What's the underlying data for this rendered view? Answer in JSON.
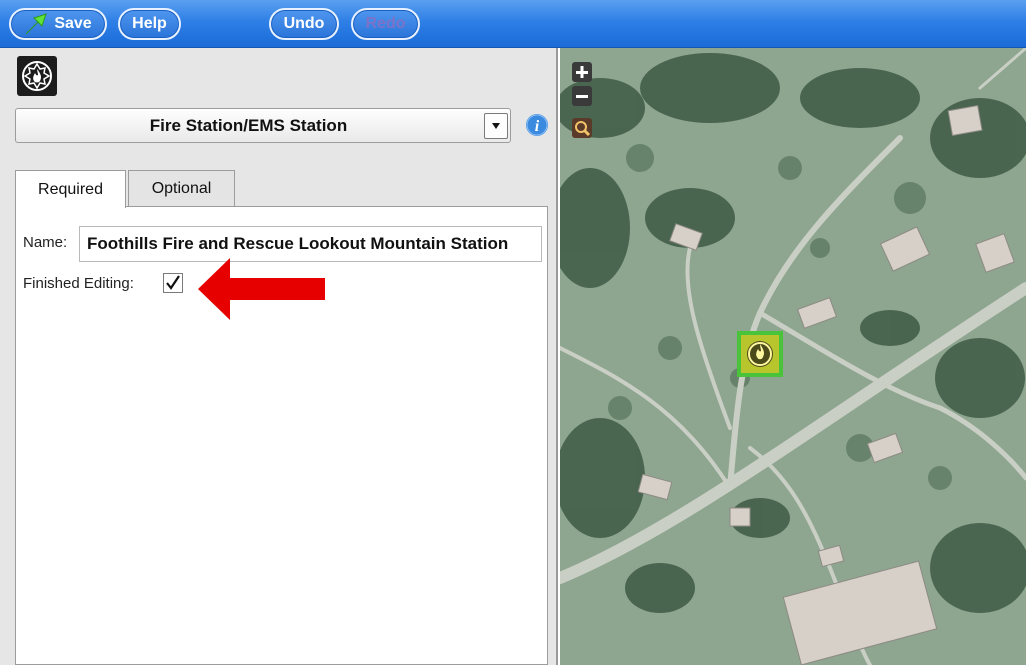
{
  "toolbar": {
    "save_label": "Save",
    "help_label": "Help",
    "undo_label": "Undo",
    "redo_label": "Redo"
  },
  "panel": {
    "type_icon": "fire-station-icon",
    "feature_type": "Fire Station/EMS Station",
    "tabs": [
      "Required",
      "Optional"
    ],
    "active_tab": "Required",
    "fields": {
      "name_label": "Name:",
      "name_value": "Foothills Fire and Rescue Lookout Mountain Station",
      "finished_label": "Finished Editing:",
      "finished_checked": true
    }
  },
  "map": {
    "zoom_in": "zoom-in-icon",
    "zoom_out": "zoom-out-icon",
    "search": "magnifier-icon",
    "marker": "fire-station-marker"
  },
  "colors": {
    "toolbar_blue": "#2e7fe6",
    "panel_gray": "#e6e6e6",
    "arrow_red": "#e60000",
    "marker_green": "#48c33a"
  }
}
